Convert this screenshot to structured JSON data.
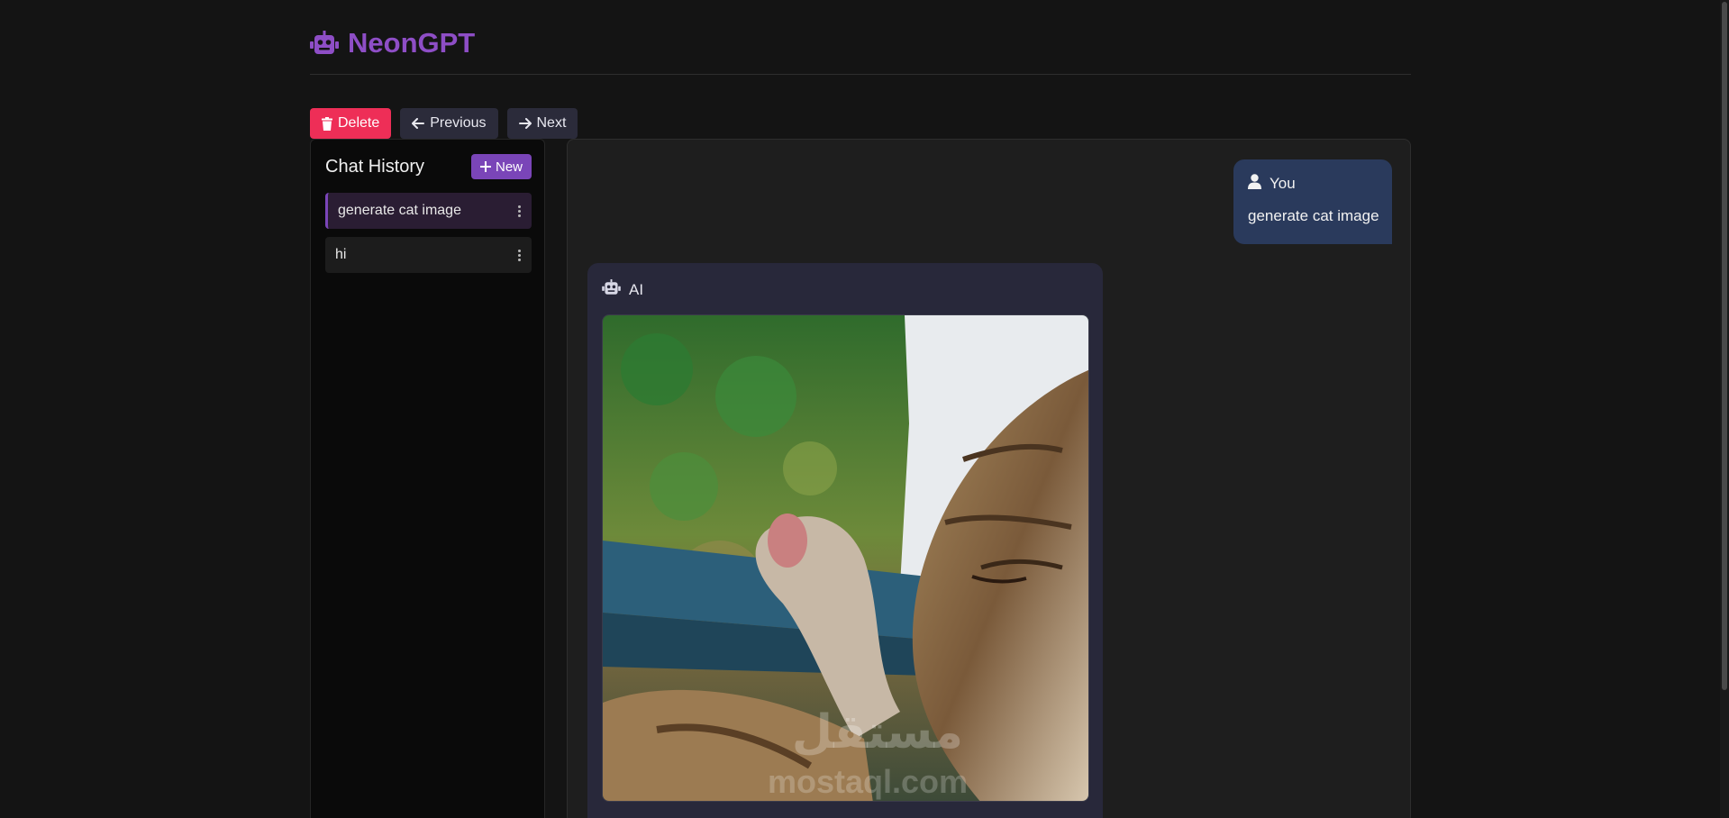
{
  "app": {
    "brand_name": "NeonGPT",
    "brand_icon": "robot-icon",
    "accent_color": "#8e4ec6"
  },
  "toolbar": {
    "delete_label": "Delete",
    "delete_icon": "trash-icon",
    "delete_color": "#ee2e57",
    "previous_label": "Previous",
    "previous_icon": "arrow-left-icon",
    "next_label": "Next",
    "next_icon": "arrow-right-icon"
  },
  "sidebar": {
    "title": "Chat History",
    "new_label": "New",
    "new_icon": "plus-icon",
    "items": [
      {
        "label": "generate cat image",
        "active": true,
        "menu_icon": "kebab-icon"
      },
      {
        "label": "hi",
        "active": false,
        "menu_icon": "kebab-icon"
      }
    ]
  },
  "chat": {
    "messages": [
      {
        "role_label": "You",
        "role_icon": "user-icon",
        "text": "generate cat image"
      },
      {
        "role_label": "AI",
        "role_icon": "robot-icon",
        "image_subject": "tabby cat licking raised paw",
        "watermark_text": "mostaql.com",
        "watermark_arabic": "مستقل"
      }
    ]
  }
}
